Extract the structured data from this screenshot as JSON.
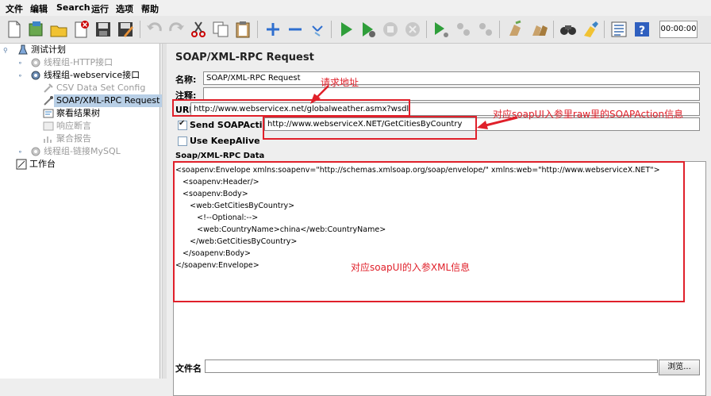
{
  "menu": [
    "文件",
    "编辑",
    "Search",
    "运行",
    "选项",
    "帮助"
  ],
  "toolbar": {
    "timer": "00:00:00",
    "icons": [
      "new-icon",
      "template-icon",
      "open-icon",
      "close-icon",
      "save-icon",
      "save-as-icon",
      "undo-icon",
      "redo-icon",
      "cut-icon",
      "copy-icon",
      "paste-icon",
      "expand-icon",
      "collapse-icon",
      "toggle-icon",
      "start-icon",
      "start-no-pause-icon",
      "stop-icon",
      "shutdown-icon",
      "remote-start-icon",
      "remote-stop-icon",
      "remote-exit-icon",
      "clear-icon",
      "clear-all-icon",
      "search-icon",
      "reset-search-icon",
      "function-helper-icon",
      "help-icon"
    ]
  },
  "tree": {
    "items": [
      {
        "label": "测试计划"
      },
      {
        "label": "线程组-HTTP接口"
      },
      {
        "label": "线程组-webservice接口"
      },
      {
        "label": "CSV Data Set Config"
      },
      {
        "label": "SOAP/XML-RPC Request"
      },
      {
        "label": "察看结果树"
      },
      {
        "label": "响应断言"
      },
      {
        "label": "聚合报告"
      },
      {
        "label": "线程组-链接MySQL"
      },
      {
        "label": "工作台"
      }
    ]
  },
  "form": {
    "title": "SOAP/XML-RPC Request",
    "name_label": "名称:",
    "name_value": "SOAP/XML-RPC Request",
    "comment_label": "注释:",
    "url_label": "URL",
    "url_value": "http://www.webservicex.net/globalweather.asmx?wsdl",
    "soap_action_label": "Send SOAPAction:",
    "soap_action_value": "http://www.webserviceX.NET/GetCitiesByCountry",
    "keepalive_label": "Use KeepAlive",
    "data_label": "Soap/XML-RPC Data",
    "xml_lines": [
      "<soapenv:Envelope xmlns:soapenv=\"http://schemas.xmlsoap.org/soap/envelope/\" xmlns:web=\"http://www.webserviceX.NET\">",
      "   <soapenv:Header/>",
      "   <soapenv:Body>",
      "      <web:GetCitiesByCountry>",
      "         <!--Optional:-->",
      "         <web:CountryName>china</web:CountryName>",
      "      </web:GetCitiesByCountry>",
      "   </soapenv:Body>",
      "</soapenv:Envelope>"
    ],
    "file_label": "文件名",
    "browse_label": "浏览..."
  },
  "annotations": {
    "url_note": "请求地址",
    "soapaction_note": "对应soapUI入参里raw里的SOAPAction信息",
    "xml_note": "对应soapUI的入参XML信息"
  },
  "colors": {
    "annotation": "#e0202a",
    "selected": "#b8cfe6"
  }
}
